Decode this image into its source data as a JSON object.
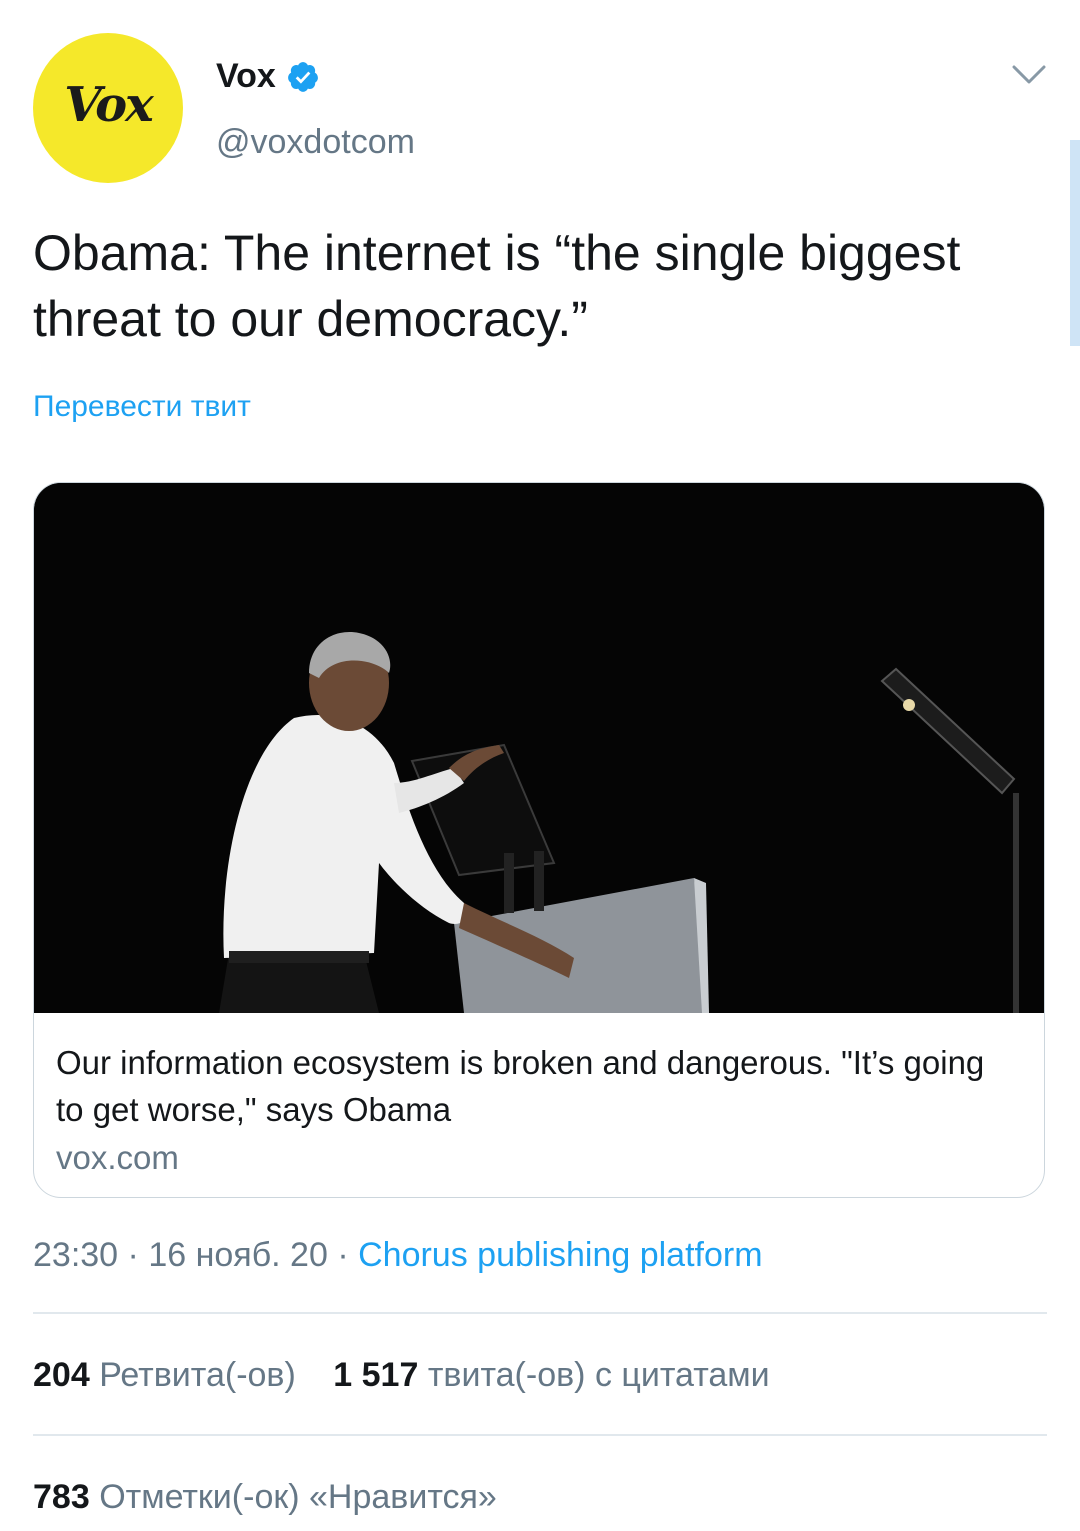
{
  "colors": {
    "accent": "#1da1f2",
    "secondary_text": "#657786",
    "avatar_bg": "#f5e82a"
  },
  "account": {
    "avatar_text": "Vox",
    "display_name": "Vox",
    "verified_icon": "verified-badge-icon",
    "handle": "@voxdotcom",
    "menu_icon": "chevron-down-icon"
  },
  "tweet": {
    "text": "Obama: The internet is “the single biggest threat to our democracy.”",
    "translate_label": "Перевести твит"
  },
  "card": {
    "title": "Our information ecosystem is broken and dangerous. \"It’s going to get worse,\" says Obama",
    "domain": "vox.com"
  },
  "meta": {
    "time": "23:30",
    "separator": "·",
    "date": "16 нояб. 20",
    "source": "Chorus publishing platform"
  },
  "stats": {
    "retweets_count": "204",
    "retweets_label": "Ретвита(-ов)",
    "quotes_count": "1 517",
    "quotes_label": "твита(-ов) с цитатами",
    "likes_count": "783",
    "likes_label": "Отметки(-ок) «Нравится»"
  }
}
